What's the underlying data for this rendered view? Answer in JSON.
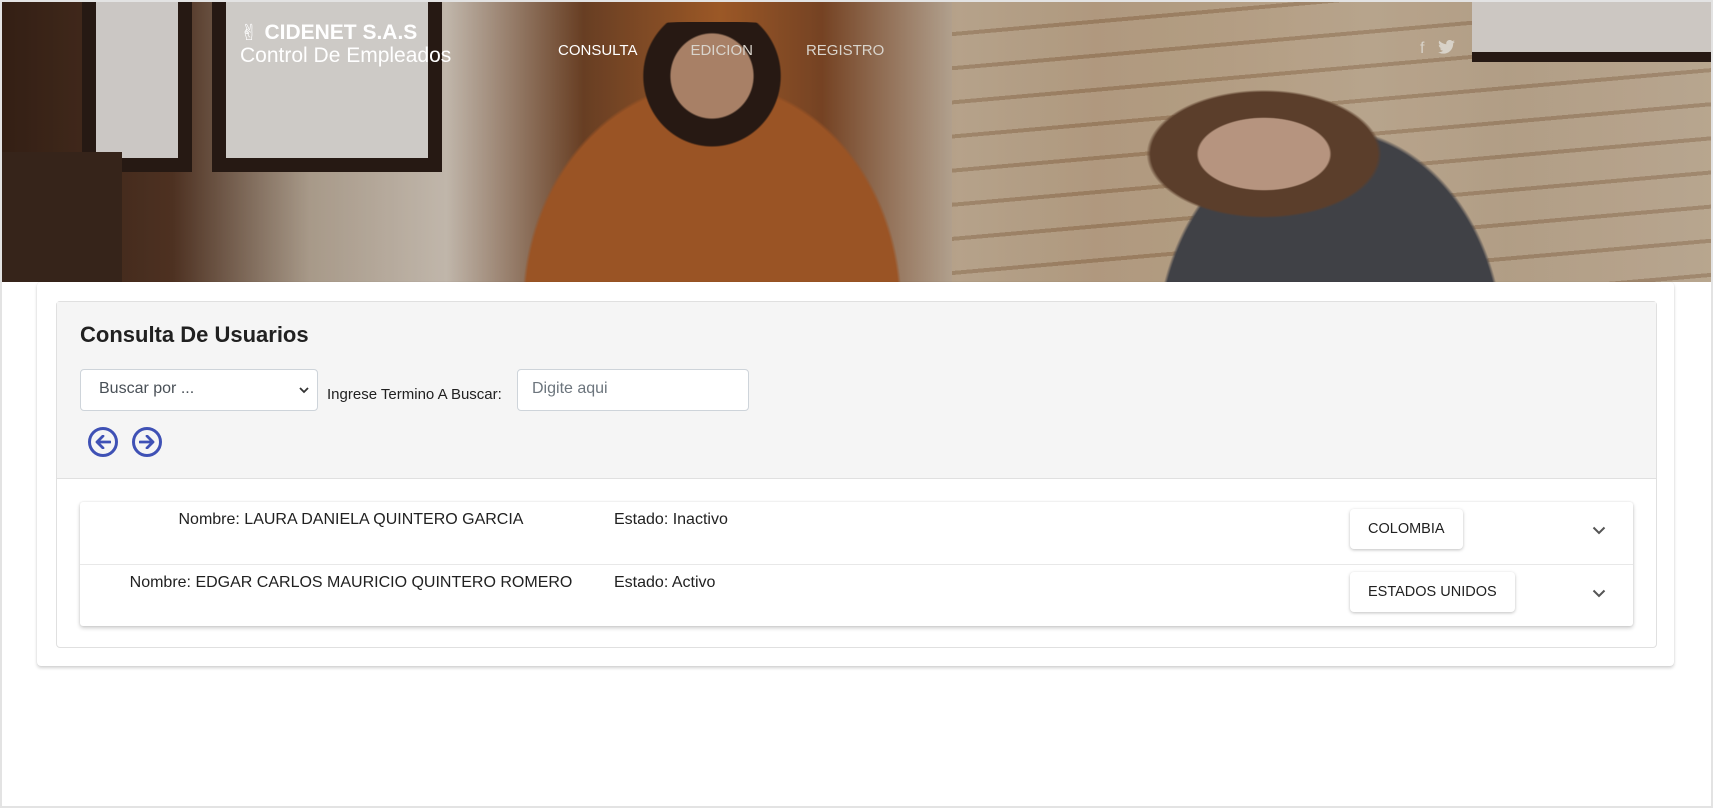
{
  "header": {
    "brand_icon": "peace-hand-icon",
    "brand_name": "CIDENET S.A.S",
    "brand_subtitle": "Control De Empleados",
    "nav": [
      {
        "label": "CONSULTA",
        "active": true
      },
      {
        "label": "EDICION",
        "active": false
      },
      {
        "label": "REGISTRO",
        "active": false
      }
    ],
    "social": [
      {
        "icon": "facebook-icon",
        "glyph": "f"
      },
      {
        "icon": "twitter-icon",
        "glyph": "🐦"
      }
    ]
  },
  "panel": {
    "title": "Consulta De Usuarios",
    "select_placeholder": "Buscar por ...",
    "search_label": "Ingrese Termino A Buscar:",
    "search_placeholder": "Digite aqui",
    "prev_icon": "←",
    "next_icon": "→"
  },
  "employees": [
    {
      "name": "Nombre: LAURA DANIELA QUINTERO GARCIA",
      "estado": "Estado: Inactivo",
      "country": "COLOMBIA"
    },
    {
      "name": "Nombre: EDGAR CARLOS MAURICIO QUINTERO ROMERO",
      "estado": "Estado: Activo",
      "country": "ESTADOS UNIDOS"
    }
  ],
  "colors": {
    "accent": "#3f51b5",
    "panel_bg": "#f5f5f5"
  }
}
